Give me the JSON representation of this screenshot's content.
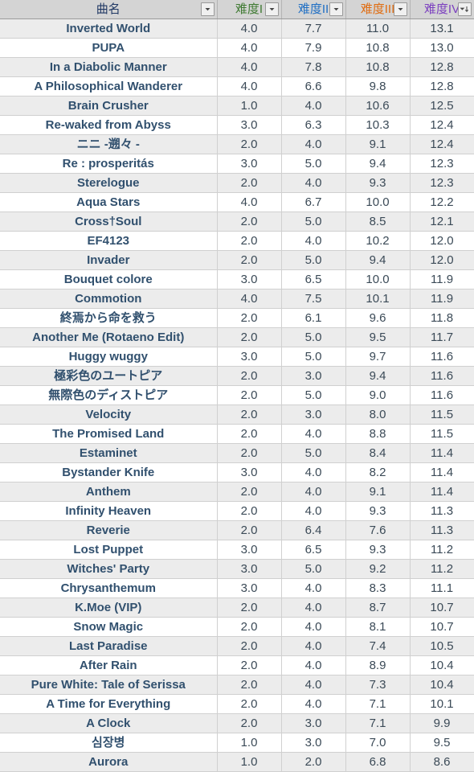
{
  "header": {
    "columns": [
      {
        "label": "曲名",
        "color": "#203864",
        "filter_icon": "chevron-down-icon",
        "sorted": false
      },
      {
        "label": "难度I",
        "color": "#3f7a32",
        "filter_icon": "chevron-down-icon",
        "sorted": false
      },
      {
        "label": "难度II",
        "color": "#1f6fc4",
        "filter_icon": "chevron-down-icon",
        "sorted": false
      },
      {
        "label": "难度III",
        "color": "#e06c10",
        "filter_icon": "chevron-down-icon",
        "sorted": false
      },
      {
        "label": "难度IV",
        "color": "#7b3fbf",
        "filter_icon": "sort-descending-icon",
        "sorted": true
      }
    ]
  },
  "table": {
    "rows": [
      {
        "title": "Inverted World",
        "d1": "4.0",
        "d2": "7.7",
        "d3": "11.0",
        "d4": "13.1"
      },
      {
        "title": "PUPA",
        "d1": "4.0",
        "d2": "7.9",
        "d3": "10.8",
        "d4": "13.0"
      },
      {
        "title": "In a Diabolic Manner",
        "d1": "4.0",
        "d2": "7.8",
        "d3": "10.8",
        "d4": "12.8"
      },
      {
        "title": "A Philosophical Wanderer",
        "d1": "4.0",
        "d2": "6.6",
        "d3": "9.8",
        "d4": "12.8"
      },
      {
        "title": "Brain Crusher",
        "d1": "1.0",
        "d2": "4.0",
        "d3": "10.6",
        "d4": "12.5"
      },
      {
        "title": "Re-waked from Abyss",
        "d1": "3.0",
        "d2": "6.3",
        "d3": "10.3",
        "d4": "12.4"
      },
      {
        "title": "ニニ -遡々 -",
        "d1": "2.0",
        "d2": "4.0",
        "d3": "9.1",
        "d4": "12.4"
      },
      {
        "title": "Re : prosperitás",
        "d1": "3.0",
        "d2": "5.0",
        "d3": "9.4",
        "d4": "12.3"
      },
      {
        "title": "Sterelogue",
        "d1": "2.0",
        "d2": "4.0",
        "d3": "9.3",
        "d4": "12.3"
      },
      {
        "title": "Aqua Stars",
        "d1": "4.0",
        "d2": "6.7",
        "d3": "10.0",
        "d4": "12.2"
      },
      {
        "title": "Cross†Soul",
        "d1": "2.0",
        "d2": "5.0",
        "d3": "8.5",
        "d4": "12.1"
      },
      {
        "title": "EF4123",
        "d1": "2.0",
        "d2": "4.0",
        "d3": "10.2",
        "d4": "12.0"
      },
      {
        "title": "Invader",
        "d1": "2.0",
        "d2": "5.0",
        "d3": "9.4",
        "d4": "12.0"
      },
      {
        "title": "Bouquet colore",
        "d1": "3.0",
        "d2": "6.5",
        "d3": "10.0",
        "d4": "11.9"
      },
      {
        "title": "Commotion",
        "d1": "4.0",
        "d2": "7.5",
        "d3": "10.1",
        "d4": "11.9"
      },
      {
        "title": "終焉から命を救う",
        "d1": "2.0",
        "d2": "6.1",
        "d3": "9.6",
        "d4": "11.8"
      },
      {
        "title": "Another Me (Rotaeno Edit)",
        "d1": "2.0",
        "d2": "5.0",
        "d3": "9.5",
        "d4": "11.7"
      },
      {
        "title": "Huggy wuggy",
        "d1": "3.0",
        "d2": "5.0",
        "d3": "9.7",
        "d4": "11.6"
      },
      {
        "title": "極彩色のユートピア",
        "d1": "2.0",
        "d2": "3.0",
        "d3": "9.4",
        "d4": "11.6"
      },
      {
        "title": "無際色のディストピア",
        "d1": "2.0",
        "d2": "5.0",
        "d3": "9.0",
        "d4": "11.6"
      },
      {
        "title": "Velocity",
        "d1": "2.0",
        "d2": "3.0",
        "d3": "8.0",
        "d4": "11.5"
      },
      {
        "title": "The Promised Land",
        "d1": "2.0",
        "d2": "4.0",
        "d3": "8.8",
        "d4": "11.5"
      },
      {
        "title": "Estaminet",
        "d1": "2.0",
        "d2": "5.0",
        "d3": "8.4",
        "d4": "11.4"
      },
      {
        "title": "Bystander Knife",
        "d1": "3.0",
        "d2": "4.0",
        "d3": "8.2",
        "d4": "11.4"
      },
      {
        "title": "Anthem",
        "d1": "2.0",
        "d2": "4.0",
        "d3": "9.1",
        "d4": "11.4"
      },
      {
        "title": "Infinity Heaven",
        "d1": "2.0",
        "d2": "4.0",
        "d3": "9.3",
        "d4": "11.3"
      },
      {
        "title": "Reverie",
        "d1": "2.0",
        "d2": "6.4",
        "d3": "7.6",
        "d4": "11.3"
      },
      {
        "title": "Lost Puppet",
        "d1": "3.0",
        "d2": "6.5",
        "d3": "9.3",
        "d4": "11.2"
      },
      {
        "title": "Witches' Party",
        "d1": "3.0",
        "d2": "5.0",
        "d3": "9.2",
        "d4": "11.2"
      },
      {
        "title": "Chrysanthemum",
        "d1": "3.0",
        "d2": "4.0",
        "d3": "8.3",
        "d4": "11.1"
      },
      {
        "title": "K.Moe (VIP)",
        "d1": "2.0",
        "d2": "4.0",
        "d3": "8.7",
        "d4": "10.7"
      },
      {
        "title": "Snow Magic",
        "d1": "2.0",
        "d2": "4.0",
        "d3": "8.1",
        "d4": "10.7"
      },
      {
        "title": "Last Paradise",
        "d1": "2.0",
        "d2": "4.0",
        "d3": "7.4",
        "d4": "10.5"
      },
      {
        "title": "After Rain",
        "d1": "2.0",
        "d2": "4.0",
        "d3": "8.9",
        "d4": "10.4"
      },
      {
        "title": "Pure White: Tale of Serissa",
        "d1": "2.0",
        "d2": "4.0",
        "d3": "7.3",
        "d4": "10.4"
      },
      {
        "title": "A Time for Everything",
        "d1": "2.0",
        "d2": "4.0",
        "d3": "7.1",
        "d4": "10.1"
      },
      {
        "title": "A Clock",
        "d1": "2.0",
        "d2": "3.0",
        "d3": "7.1",
        "d4": "9.9"
      },
      {
        "title": "심장병",
        "d1": "1.0",
        "d2": "3.0",
        "d3": "7.0",
        "d4": "9.5"
      },
      {
        "title": "Aurora",
        "d1": "1.0",
        "d2": "2.0",
        "d3": "6.8",
        "d4": "8.6"
      }
    ]
  }
}
